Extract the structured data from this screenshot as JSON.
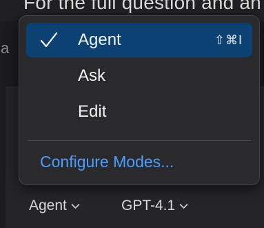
{
  "background": {
    "top_text": "For the full question and an",
    "left_glyph": "a"
  },
  "menu": {
    "items": [
      {
        "label": "Agent",
        "shortcut": "⇧⌘I",
        "selected": true,
        "icon": "checkmark-icon"
      },
      {
        "label": "Ask",
        "selected": false
      },
      {
        "label": "Edit",
        "selected": false
      }
    ],
    "configure_label": "Configure Modes..."
  },
  "footer": {
    "mode_label": "Agent",
    "model_label": "GPT-4.1",
    "chevron_icon": "chevron-down-icon"
  },
  "colors": {
    "selected_bg": "#0c4273",
    "link": "#4a9eff",
    "menu_bg": "#2a2a2c"
  }
}
